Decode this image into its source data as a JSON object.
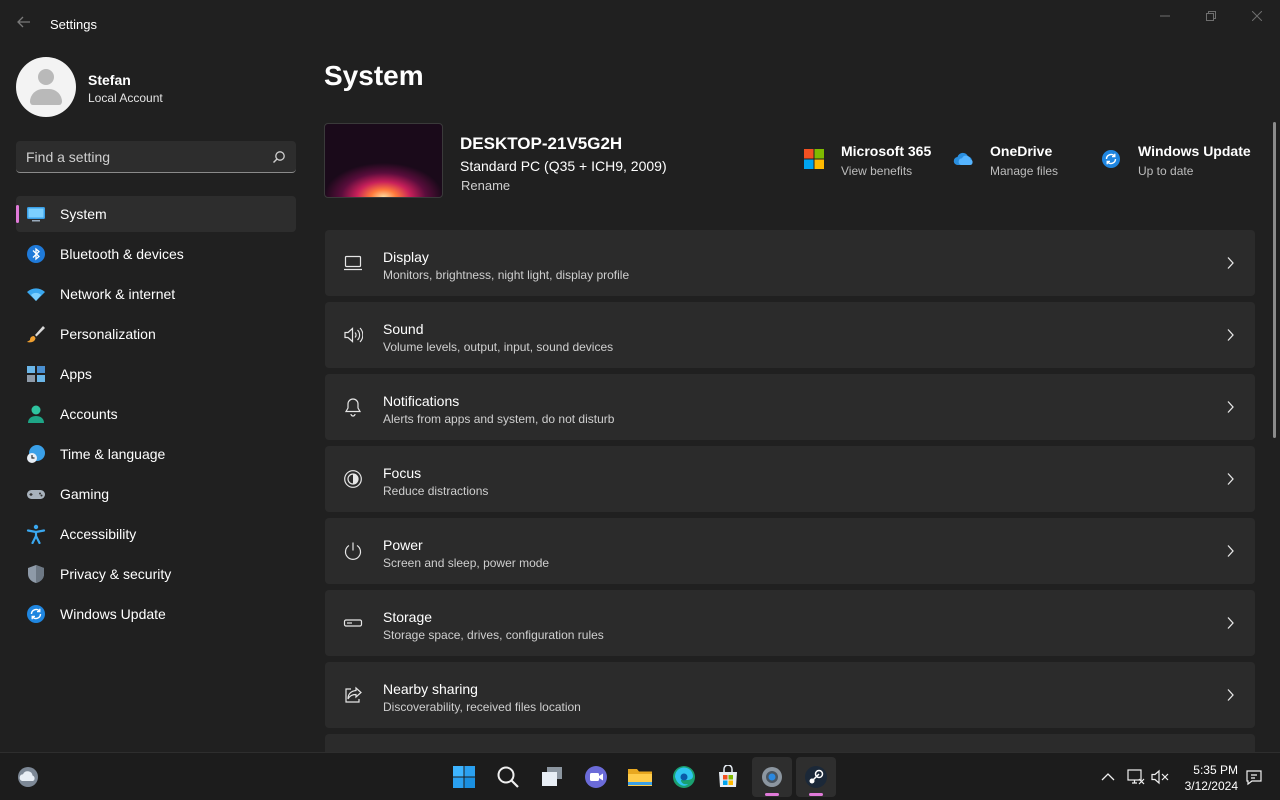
{
  "window": {
    "title": "Settings"
  },
  "profile": {
    "name": "Stefan",
    "account_type": "Local Account"
  },
  "search": {
    "placeholder": "Find a setting"
  },
  "sidebar": {
    "items": [
      {
        "label": "System",
        "icon": "system-icon",
        "active": true
      },
      {
        "label": "Bluetooth & devices",
        "icon": "bluetooth-icon"
      },
      {
        "label": "Network & internet",
        "icon": "wifi-icon"
      },
      {
        "label": "Personalization",
        "icon": "brush-icon"
      },
      {
        "label": "Apps",
        "icon": "apps-icon"
      },
      {
        "label": "Accounts",
        "icon": "person-icon"
      },
      {
        "label": "Time & language",
        "icon": "clock-globe-icon"
      },
      {
        "label": "Gaming",
        "icon": "gamepad-icon"
      },
      {
        "label": "Accessibility",
        "icon": "accessibility-icon"
      },
      {
        "label": "Privacy & security",
        "icon": "shield-icon"
      },
      {
        "label": "Windows Update",
        "icon": "update-icon"
      }
    ]
  },
  "main": {
    "title": "System",
    "device": {
      "name": "DESKTOP-21V5G2H",
      "model": "Standard PC (Q35 + ICH9, 2009)",
      "rename_label": "Rename"
    },
    "quick_links": [
      {
        "title": "Microsoft 365",
        "subtitle": "View benefits",
        "icon": "microsoft-logo-icon"
      },
      {
        "title": "OneDrive",
        "subtitle": "Manage files",
        "icon": "cloud-icon"
      },
      {
        "title": "Windows Update",
        "subtitle": "Up to date",
        "icon": "update-icon"
      }
    ],
    "cards": [
      {
        "title": "Display",
        "subtitle": "Monitors, brightness, night light, display profile",
        "icon": "monitor-icon"
      },
      {
        "title": "Sound",
        "subtitle": "Volume levels, output, input, sound devices",
        "icon": "speaker-icon"
      },
      {
        "title": "Notifications",
        "subtitle": "Alerts from apps and system, do not disturb",
        "icon": "bell-icon"
      },
      {
        "title": "Focus",
        "subtitle": "Reduce distractions",
        "icon": "focus-icon"
      },
      {
        "title": "Power",
        "subtitle": "Screen and sleep, power mode",
        "icon": "power-icon"
      },
      {
        "title": "Storage",
        "subtitle": "Storage space, drives, configuration rules",
        "icon": "storage-icon"
      },
      {
        "title": "Nearby sharing",
        "subtitle": "Discoverability, received files location",
        "icon": "share-icon"
      }
    ]
  },
  "taskbar": {
    "apps": [
      "start-icon",
      "search-icon",
      "task-view-icon",
      "chat-icon",
      "file-explorer-icon",
      "edge-icon",
      "store-icon",
      "settings-icon",
      "steam-icon"
    ],
    "clock": {
      "time": "5:35 PM",
      "date": "3/12/2024"
    }
  },
  "colors": {
    "accent": "#e07ad9",
    "background": "#202020",
    "card": "#2b2b2b"
  }
}
